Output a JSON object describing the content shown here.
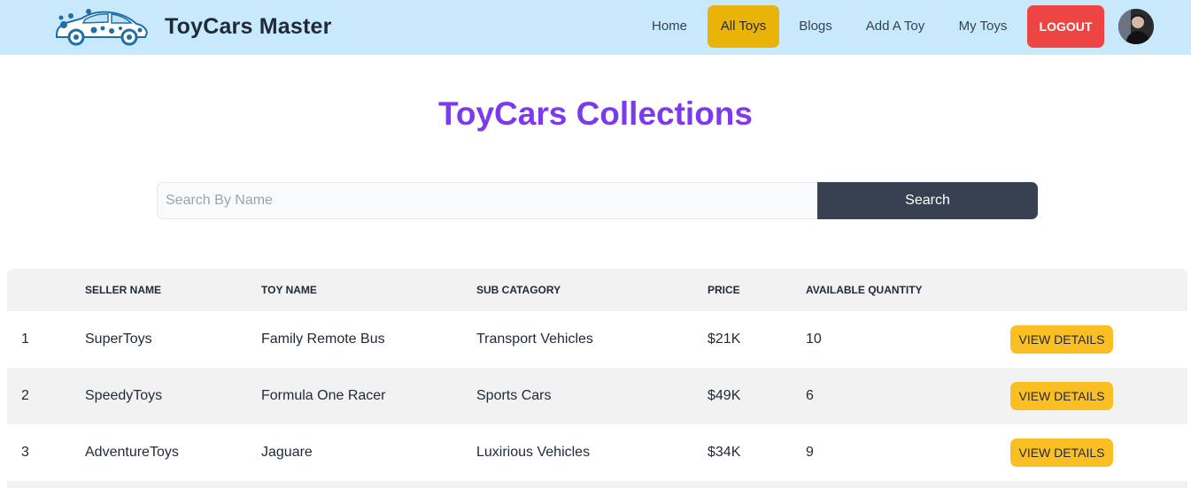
{
  "header": {
    "brand_name": "ToyCars Master",
    "nav": {
      "home": "Home",
      "all_toys": "All Toys",
      "blogs": "Blogs",
      "add_toy": "Add A Toy",
      "my_toys": "My Toys"
    },
    "logout_label": "LOGOUT",
    "active_nav": "All Toys"
  },
  "main": {
    "title": "ToyCars Collections",
    "search": {
      "placeholder": "Search By Name",
      "value": "",
      "button_label": "Search"
    },
    "table": {
      "columns": [
        "",
        "SELLER NAME",
        "TOY NAME",
        "SUB CATAGORY",
        "PRICE",
        "AVAILABLE QUANTITY",
        ""
      ],
      "rows": [
        {
          "index": "1",
          "seller": "SuperToys",
          "toy": "Family Remote Bus",
          "sub_category": "Transport Vehicles",
          "price": "$21K",
          "quantity": "10",
          "action": "VIEW DETAILS"
        },
        {
          "index": "2",
          "seller": "SpeedyToys",
          "toy": "Formula One Racer",
          "sub_category": "Sports Cars",
          "price": "$49K",
          "quantity": "6",
          "action": "VIEW DETAILS"
        },
        {
          "index": "3",
          "seller": "AdventureToys",
          "toy": "Jaguare",
          "sub_category": "Luxirious Vehicles",
          "price": "$34K",
          "quantity": "9",
          "action": "VIEW DETAILS"
        }
      ]
    }
  },
  "colors": {
    "navbar_bg": "#c8e9fb",
    "active_nav_bg": "#eab308",
    "logout_bg": "#ef4444",
    "title": "#7c3aed",
    "search_button_bg": "#374151",
    "view_button_bg": "#fbbf24",
    "alt_row_bg": "#f2f2f2"
  },
  "icons": {
    "logo": "toy-car-logo-icon",
    "avatar": "user-avatar"
  }
}
